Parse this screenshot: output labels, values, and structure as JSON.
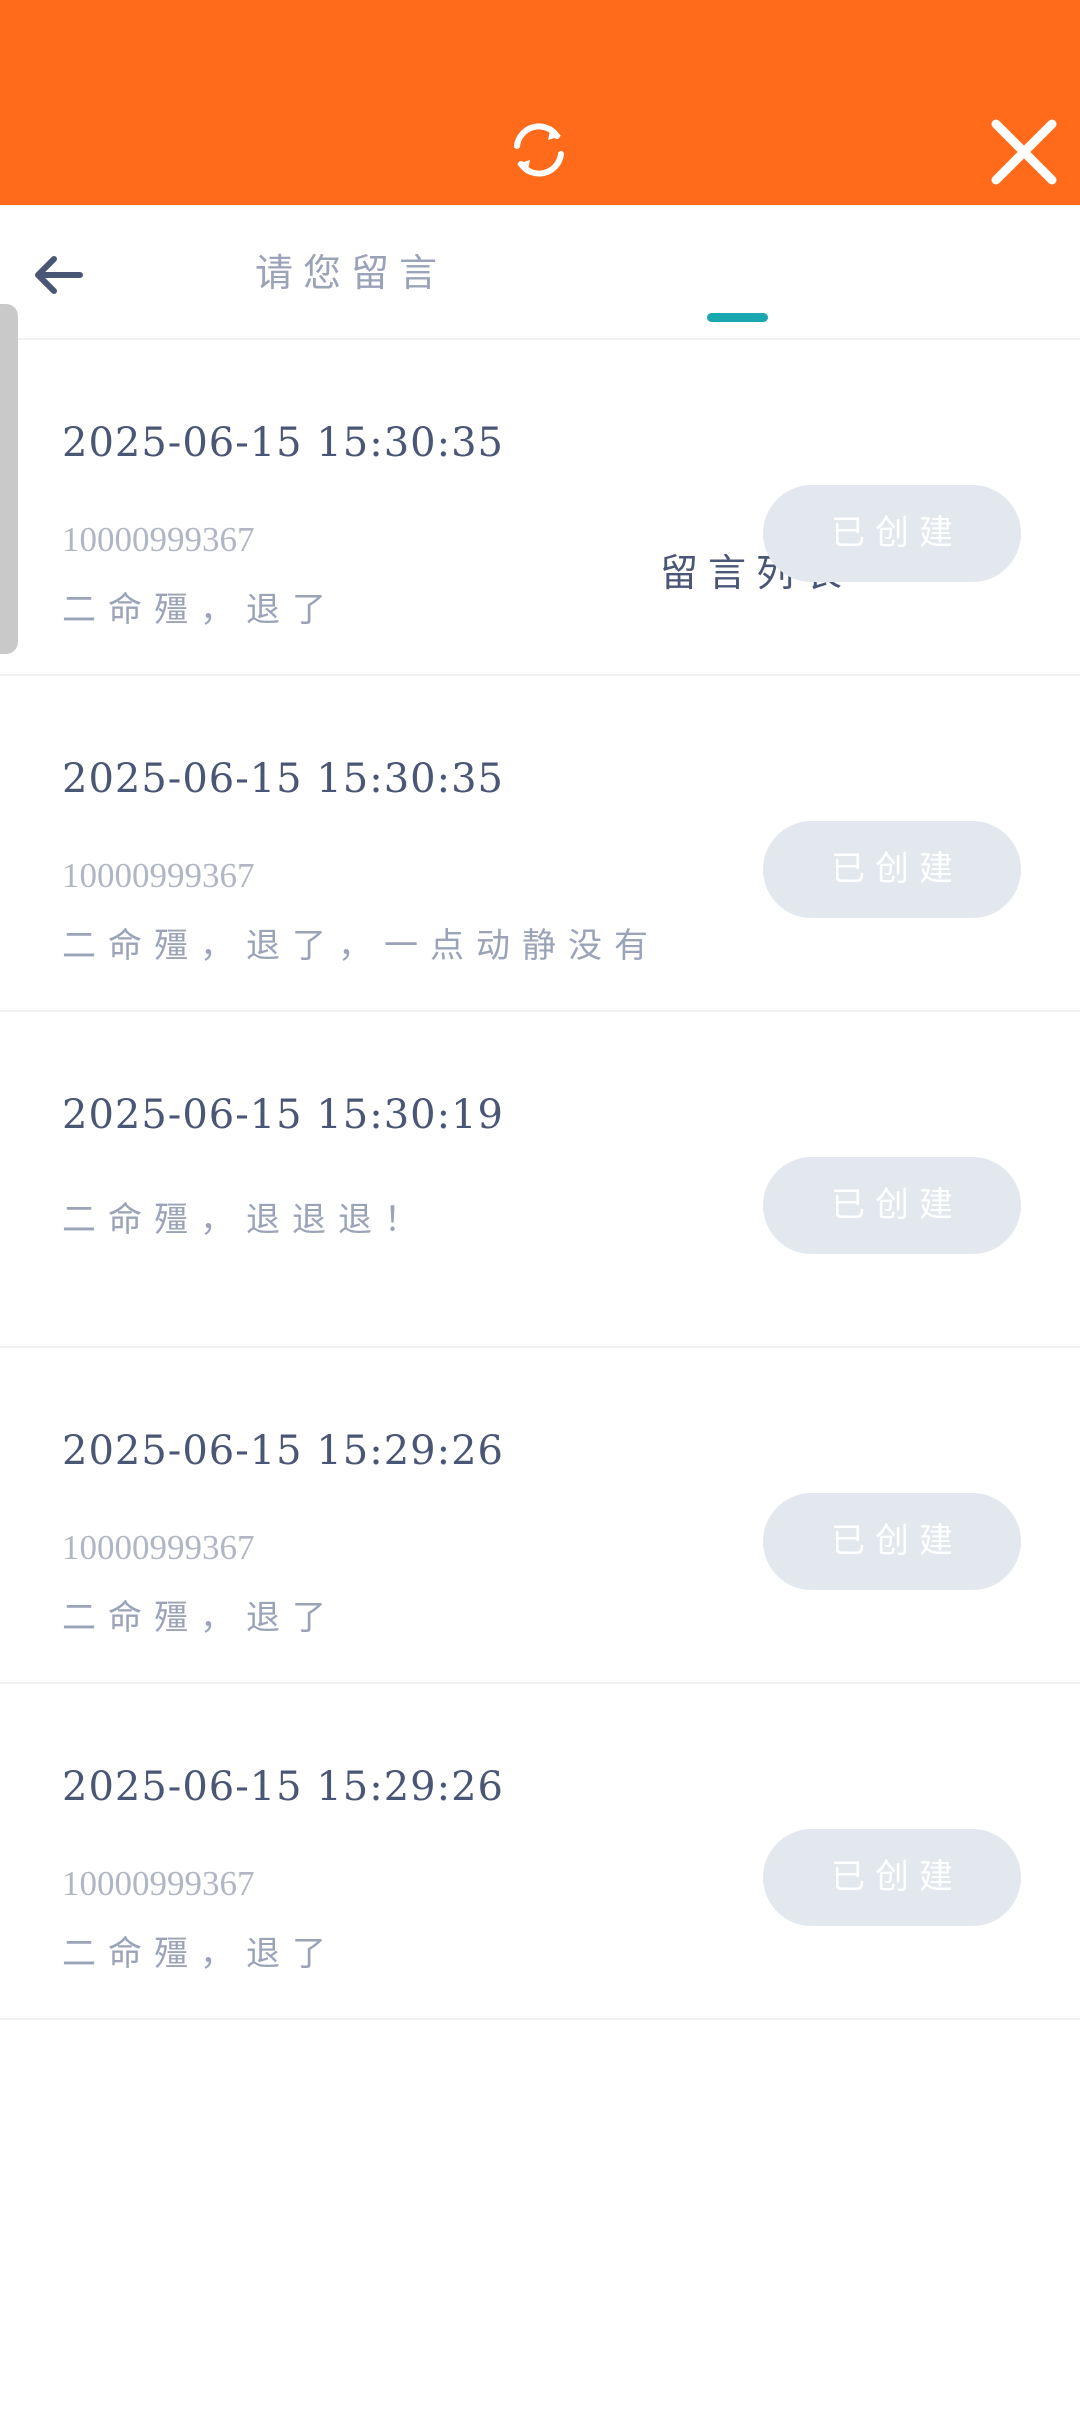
{
  "header": {
    "refresh_icon": "refresh-icon",
    "close_icon": "close-icon",
    "background_color": "#ff6b1a"
  },
  "tabs": {
    "back_icon": "back-arrow-icon",
    "items": [
      {
        "label": "请您留言",
        "active": false
      },
      {
        "label": "留言列表",
        "active": true
      }
    ],
    "accent_color": "#19a8b0"
  },
  "messages": [
    {
      "time": "2025-06-15 15:30:35",
      "account": "10000999367",
      "text": "二命殭，退了",
      "status": "已创建"
    },
    {
      "time": "2025-06-15 15:30:35",
      "account": "10000999367",
      "text": "二命殭，退了，一点动静没有",
      "status": "已创建"
    },
    {
      "time": "2025-06-15 15:30:19",
      "account": "",
      "text": "二命殭，退退退！",
      "status": "已创建"
    },
    {
      "time": "2025-06-15 15:29:26",
      "account": "10000999367",
      "text": "二命殭，退了",
      "status": "已创建"
    },
    {
      "time": "2025-06-15 15:29:26",
      "account": "10000999367",
      "text": "二命殭，退了",
      "status": "已创建"
    }
  ]
}
